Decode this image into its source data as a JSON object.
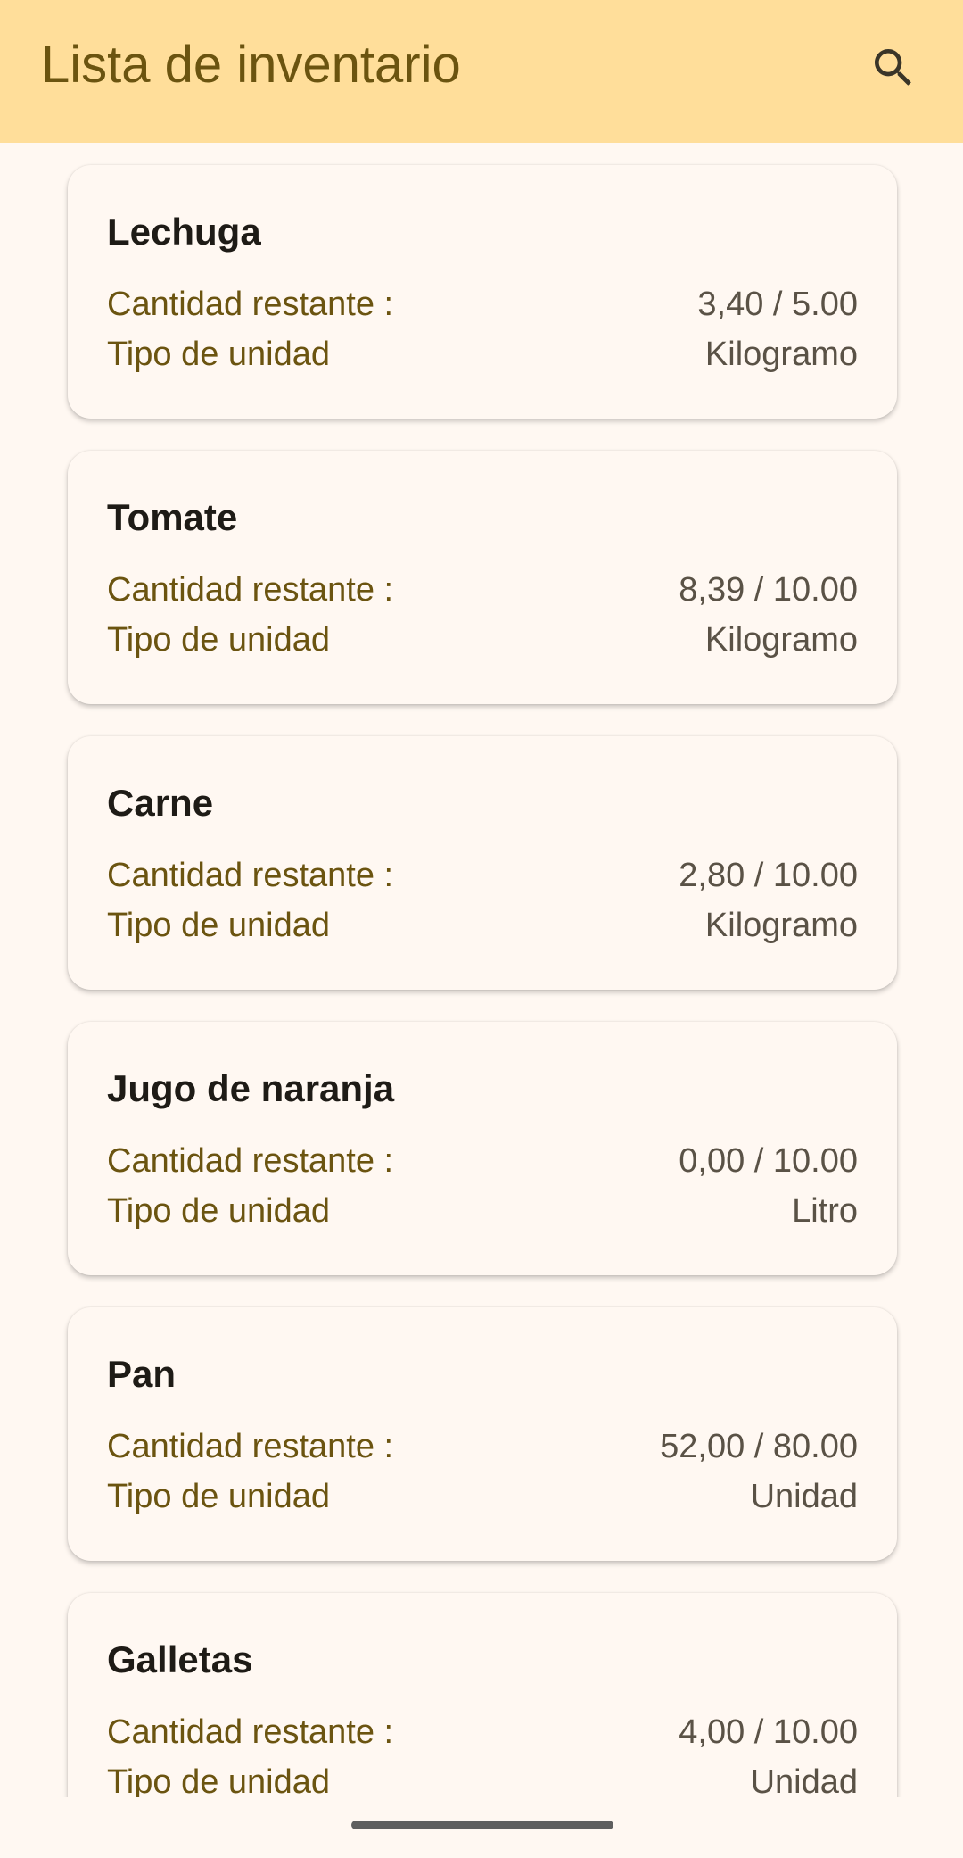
{
  "app_bar": {
    "title": "Lista de inventario",
    "search_icon": "search-icon",
    "background": "#FFDE9A"
  },
  "items": [
    {
      "name": "Lechuga",
      "qty_label": "Cantidad restante :",
      "qty_value": "3,40 / 5.00",
      "unit_label": "Tipo de unidad",
      "unit_value": "Kilogramo"
    },
    {
      "name": "Tomate",
      "qty_label": "Cantidad restante :",
      "qty_value": "8,39 / 10.00",
      "unit_label": "Tipo de unidad",
      "unit_value": "Kilogramo"
    },
    {
      "name": "Carne",
      "qty_label": "Cantidad restante :",
      "qty_value": "2,80 / 10.00",
      "unit_label": "Tipo de unidad",
      "unit_value": "Kilogramo"
    },
    {
      "name": "Jugo de naranja",
      "qty_label": "Cantidad restante :",
      "qty_value": "0,00 / 10.00",
      "unit_label": "Tipo de unidad",
      "unit_value": "Litro"
    },
    {
      "name": "Pan",
      "qty_label": "Cantidad restante :",
      "qty_value": "52,00 / 80.00",
      "unit_label": "Tipo de unidad",
      "unit_value": "Unidad"
    },
    {
      "name": "Galletas",
      "qty_label": "Cantidad restante :",
      "qty_value": "4,00 / 10.00",
      "unit_label": "Tipo de unidad",
      "unit_value": "Unidad"
    }
  ],
  "colors": {
    "accent_text": "#6B5410",
    "surface": "#FFF8F2"
  }
}
